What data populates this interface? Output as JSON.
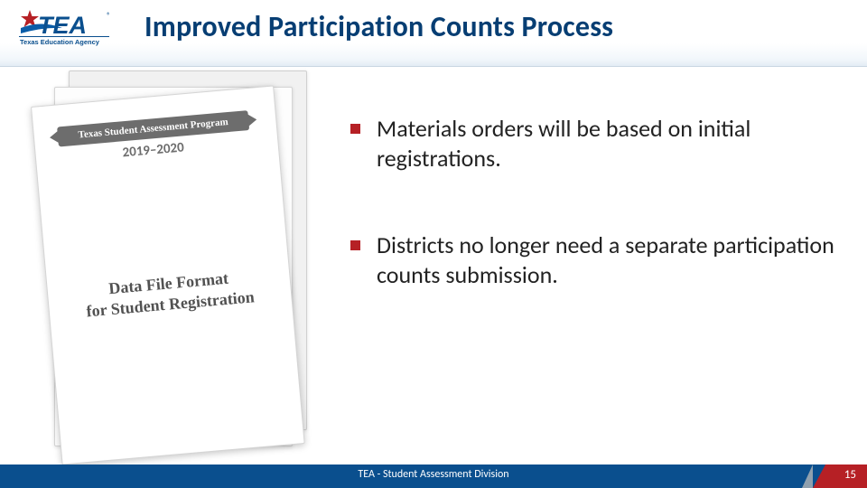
{
  "logo_alt": "TEA Texas Education Agency",
  "slide_title": "Improved Participation Counts Process",
  "document": {
    "ribbon": "Texas Student Assessment Program",
    "year": "2019–2020",
    "title_line_1": "Data File Format",
    "title_line_2": "for Student Registration"
  },
  "bullets": [
    "Materials orders will be based on initial registrations.",
    "Districts no longer need a separate participation counts submission."
  ],
  "footer": {
    "center": "TEA - Student Assessment Division",
    "page": "15"
  },
  "colors": {
    "brand_blue": "#0a4f8e",
    "accent_red": "#b62025"
  }
}
